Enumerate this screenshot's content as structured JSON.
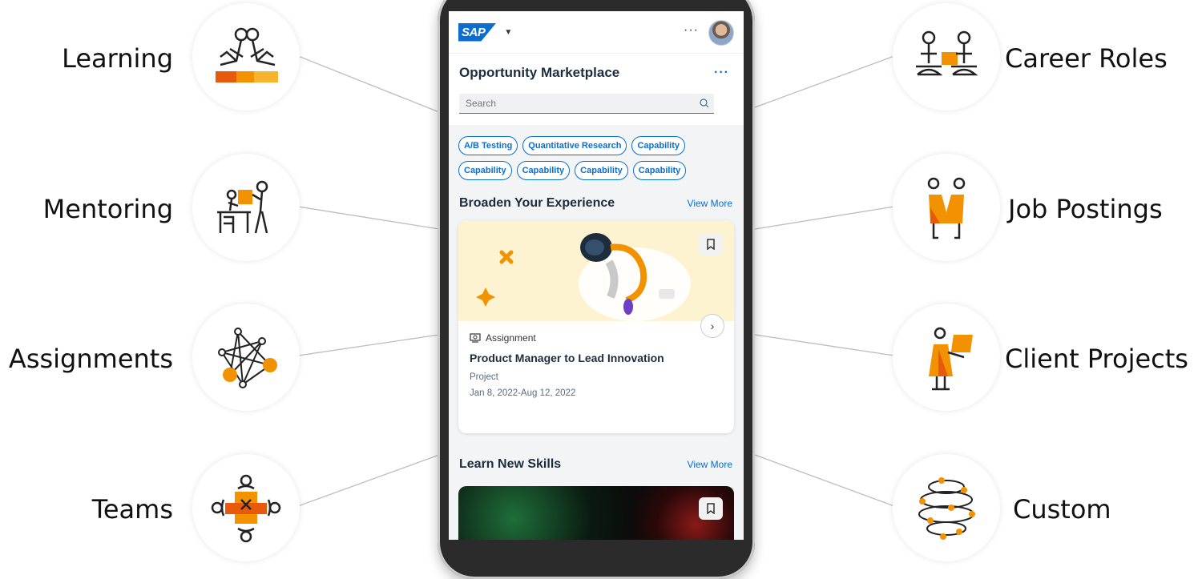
{
  "features_left": [
    {
      "label": "Learning",
      "icon": "learning-icon"
    },
    {
      "label": "Mentoring",
      "icon": "mentoring-icon"
    },
    {
      "label": "Assignments",
      "icon": "assignments-icon"
    },
    {
      "label": "Teams",
      "icon": "teams-icon"
    }
  ],
  "features_right": [
    {
      "label": "Career Roles",
      "icon": "career-roles-icon"
    },
    {
      "label": "Job Postings",
      "icon": "job-postings-icon"
    },
    {
      "label": "Client Projects",
      "icon": "client-projects-icon"
    },
    {
      "label": "Custom",
      "icon": "custom-icon"
    }
  ],
  "app": {
    "logo": "SAP",
    "title": "Opportunity Marketplace",
    "search_placeholder": "Search",
    "chips": [
      "A/B Testing",
      "Quantitative Research",
      "Capability",
      "Capability",
      "Capability",
      "Capability",
      "Capability"
    ],
    "sections": {
      "broaden": {
        "title": "Broaden Your Experience",
        "view_more": "View More"
      },
      "learn": {
        "title": "Learn New Skills",
        "view_more": "View More"
      }
    },
    "card": {
      "type": "Assignment",
      "title": "Product Manager to Lead Innovation",
      "subtitle": "Project",
      "dates": "Jan 8, 2022-Aug 12, 2022"
    }
  },
  "colors": {
    "accent": "#0a6ed1",
    "orange": "#f39200",
    "card_bg": "#fdf3d0"
  }
}
